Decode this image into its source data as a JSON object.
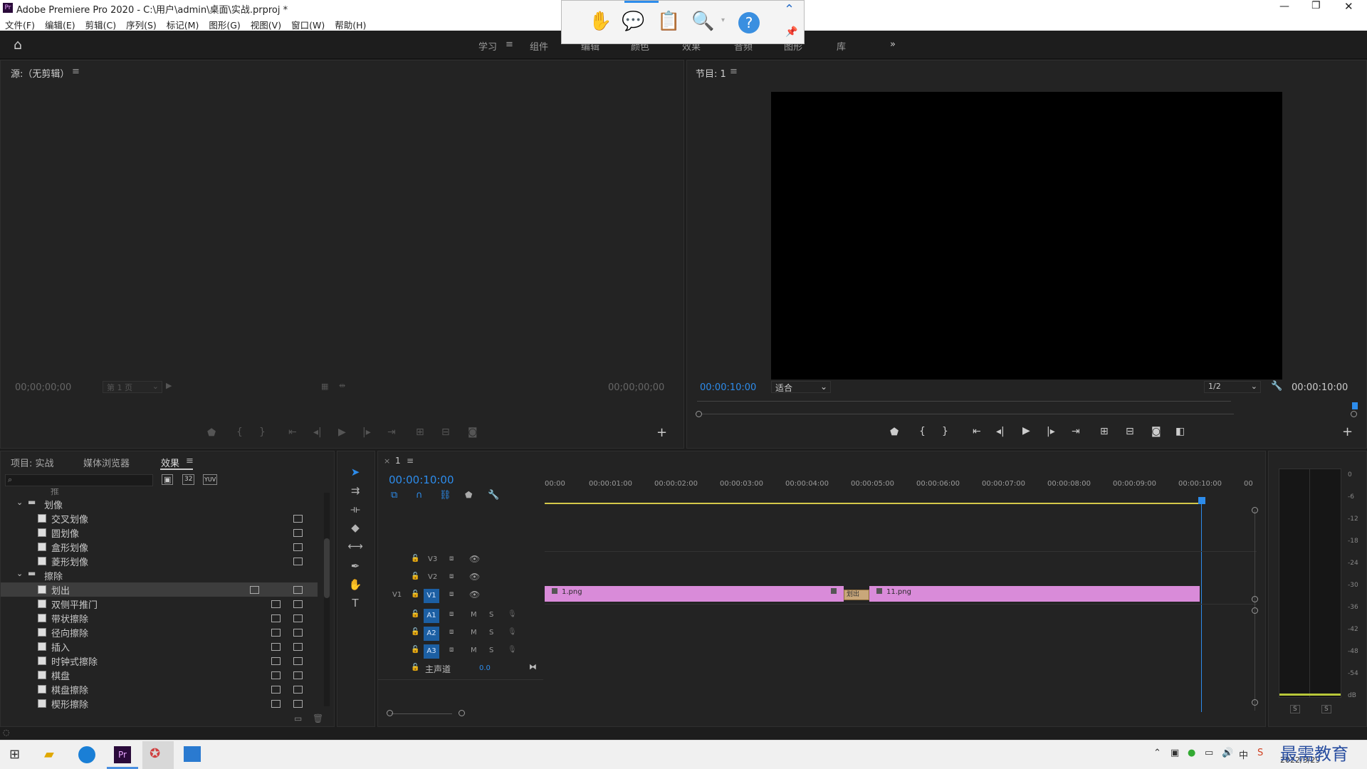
{
  "window": {
    "title": "Adobe Premiere Pro 2020 - C:\\用户\\admin\\桌面\\实战.prproj *"
  },
  "menu": [
    "文件(F)",
    "编辑(E)",
    "剪辑(C)",
    "序列(S)",
    "标记(M)",
    "图形(G)",
    "视图(V)",
    "窗口(W)",
    "帮助(H)"
  ],
  "workspaces": [
    "学习",
    "组件",
    "编辑",
    "颜色",
    "效果",
    "音频",
    "图形",
    "库"
  ],
  "source": {
    "title": "源:（无剪辑）",
    "tc_left": "00;00;00;00",
    "tc_right": "00;00;00;00",
    "page": "第 1 页"
  },
  "program": {
    "title": "节目: 1",
    "timecode": "00:00:10:00",
    "fit": "适合",
    "res": "1/2",
    "tc_right": "00:00:10:00"
  },
  "project_tabs": [
    "项目: 实战",
    "媒体浏览器",
    "效果"
  ],
  "effects_tree": [
    {
      "type": "folder",
      "label": "划像"
    },
    {
      "type": "item",
      "label": "交叉划像"
    },
    {
      "type": "item",
      "label": "圆划像"
    },
    {
      "type": "item",
      "label": "盒形划像"
    },
    {
      "type": "item",
      "label": "菱形划像"
    },
    {
      "type": "folder",
      "label": "擦除"
    },
    {
      "type": "item",
      "label": "划出",
      "selected": true
    },
    {
      "type": "item",
      "label": "双侧平推门"
    },
    {
      "type": "item",
      "label": "带状擦除"
    },
    {
      "type": "item",
      "label": "径向擦除"
    },
    {
      "type": "item",
      "label": "插入"
    },
    {
      "type": "item",
      "label": "时钟式擦除"
    },
    {
      "type": "item",
      "label": "棋盘"
    },
    {
      "type": "item",
      "label": "棋盘擦除"
    },
    {
      "type": "item",
      "label": "楔形擦除"
    }
  ],
  "effects_badges": {
    "acc": "32",
    "yuv": "YUV"
  },
  "effects_partial": "推",
  "timeline": {
    "tab": "1",
    "timecode": "00:00:10:00",
    "ruler": [
      "00:00",
      "00:00:01:00",
      "00:00:02:00",
      "00:00:03:00",
      "00:00:04:00",
      "00:00:05:00",
      "00:00:06:00",
      "00:00:07:00",
      "00:00:08:00",
      "00:00:09:00",
      "00:00:10:00",
      "00"
    ],
    "video_tracks": [
      "V3",
      "V2",
      "V1"
    ],
    "audio_tracks": [
      "A1",
      "A2",
      "A3"
    ],
    "src_patch": "V1",
    "master": {
      "label": "主声道",
      "value": "0.0"
    },
    "clips": [
      {
        "label": "1.png"
      },
      {
        "label": "11.png"
      }
    ],
    "transition": "划出",
    "track_btns": {
      "m": "M",
      "s": "S"
    }
  },
  "meter": {
    "scale": [
      "0",
      "-6",
      "-12",
      "-18",
      "-24",
      "-30",
      "-36",
      "-42",
      "-48",
      "-54",
      "dB"
    ],
    "solo": [
      "S",
      "S"
    ]
  },
  "taskbar": {
    "date": "2022/3/29",
    "watermark": "最需教育"
  }
}
